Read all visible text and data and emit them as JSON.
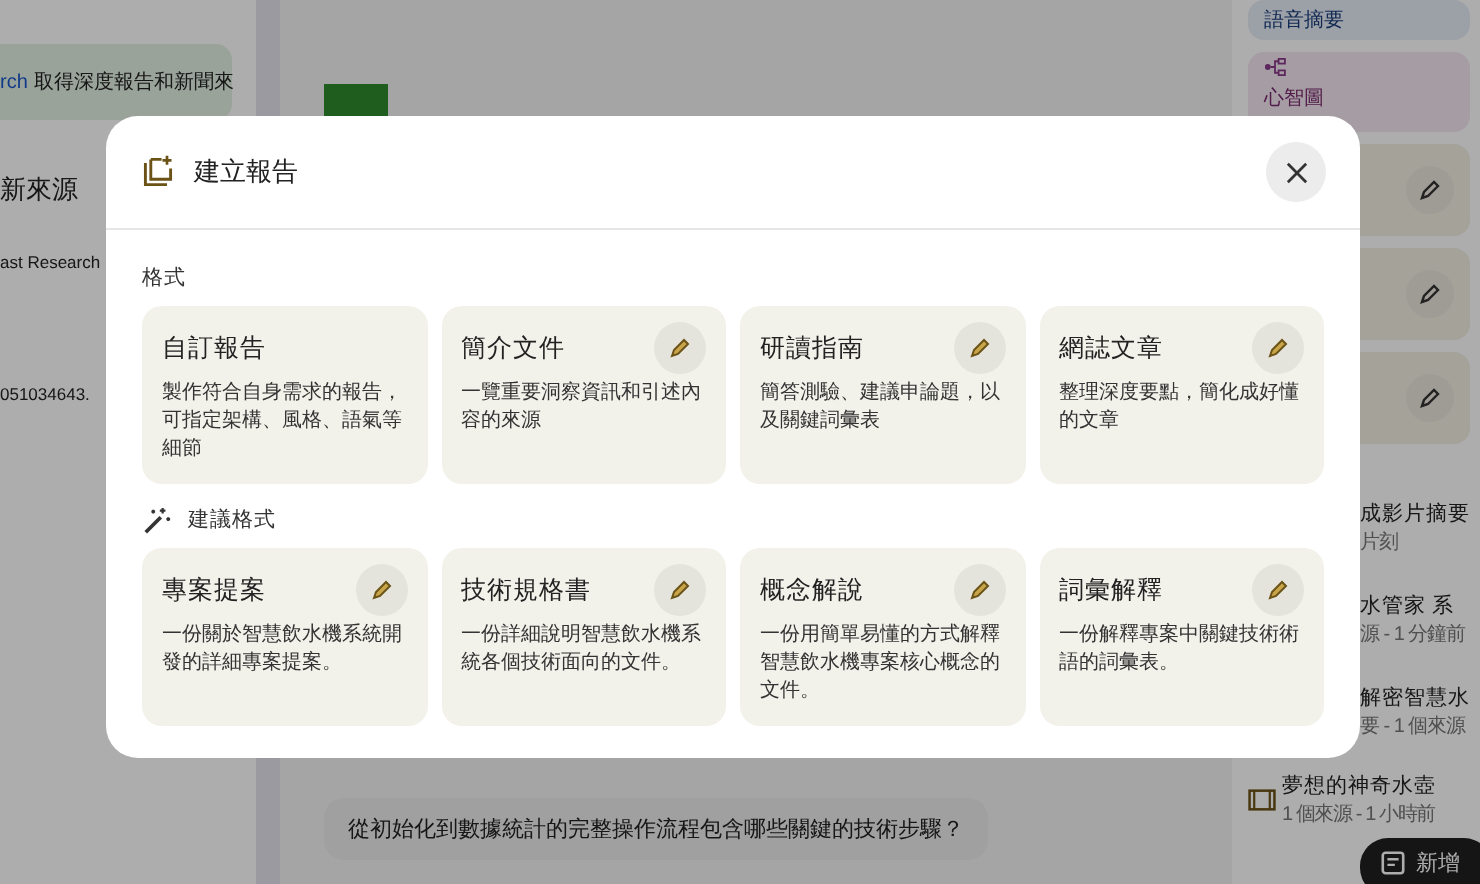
{
  "background": {
    "left_sidebar": {
      "banner_link": "rch",
      "banner_text": "取得深度報告和新聞來",
      "items": [
        "新來源",
        "ast Research",
        "051034643."
      ]
    },
    "chat": {
      "question": "從初始化到數據統計的完整操作流程包含哪些關鍵的技術步驟？"
    },
    "studio": {
      "tiles": [
        {
          "kind": "audio",
          "label": "語音摘要"
        },
        {
          "kind": "mindmap",
          "label": "心智圖"
        },
        {
          "kind": "report"
        },
        {
          "kind": "report"
        },
        {
          "kind": "report"
        }
      ],
      "notes": [
        {
          "kind": "note",
          "title": "成影片摘要",
          "meta": "片刻"
        },
        {
          "kind": "note",
          "title": "水管家 系",
          "meta": "源 - 1 分鐘前"
        },
        {
          "kind": "note",
          "title": "解密智慧水",
          "meta": "要 - 1 個來源"
        },
        {
          "kind": "video",
          "title": "夢想的神奇水壺",
          "meta": "1 個來源 - 1 小時前"
        }
      ],
      "add_button": "新增"
    }
  },
  "dialog": {
    "title": "建立報告",
    "sections": [
      {
        "kind": "formats",
        "heading": "格式",
        "cards": [
          {
            "title": "自訂報告",
            "description": "製作符合自身需求的報告，可指定架構、風格、語氣等細節",
            "editable": false
          },
          {
            "title": "簡介文件",
            "description": "一覽重要洞察資訊和引述內容的來源",
            "editable": true
          },
          {
            "title": "研讀指南",
            "description": "簡答測驗、建議申論題，以及關鍵詞彙表",
            "editable": true
          },
          {
            "title": "網誌文章",
            "description": "整理深度要點，簡化成好懂的文章",
            "editable": true
          }
        ]
      },
      {
        "kind": "suggested",
        "heading": "建議格式",
        "cards": [
          {
            "title": "專案提案",
            "description": "一份關於智慧飲水機系統開發的詳細專案提案。",
            "editable": true
          },
          {
            "title": "技術規格書",
            "description": "一份詳細說明智慧飲水機系統各個技術面向的文件。",
            "editable": true
          },
          {
            "title": "概念解說",
            "description": "一份用簡單易懂的方式解釋智慧飲水機專案核心概念的文件。",
            "editable": true
          },
          {
            "title": "詞彙解釋",
            "description": "一份解釋專案中關鍵技術術語的詞彙表。",
            "editable": true
          }
        ]
      }
    ]
  }
}
